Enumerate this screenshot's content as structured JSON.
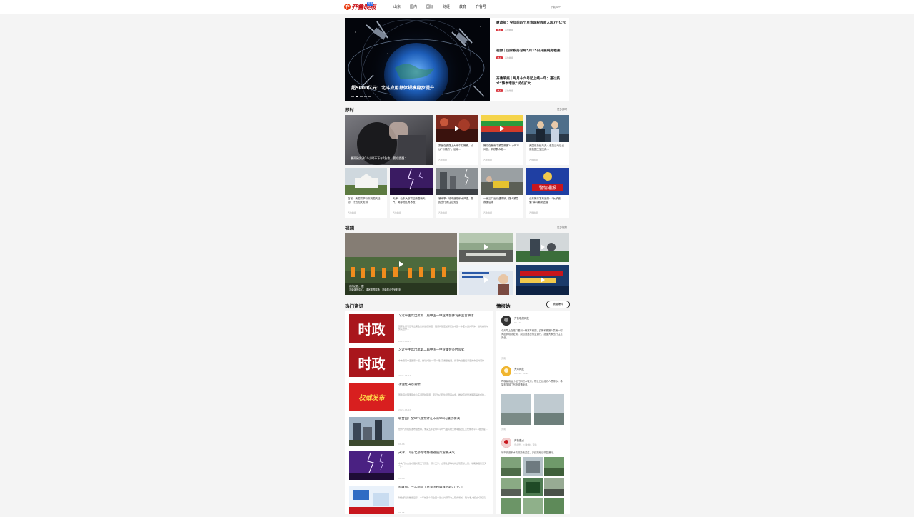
{
  "header": {
    "logo_glyph": "齐",
    "logo_text": "齐鲁晚报",
    "logo_badge": "齐鲁",
    "nav": [
      "山东",
      "国内",
      "国际",
      "财经",
      "教育",
      "齐鲁号"
    ],
    "download": "下载APP"
  },
  "hero": {
    "caption": "超5000亿元！北斗应用总体规模稳步提升",
    "active_slide": 1,
    "slides": 5
  },
  "side_news": [
    {
      "title": "财政部：今年前四个月我国税收收入超7万亿元",
      "tag": "热点",
      "source": "齐鲁晚报"
    },
    {
      "title": "视频｜国家税务总局5月15日开展税务稽查",
      "tag": "热点",
      "source": "齐鲁晚报"
    },
    {
      "title": "齐鲁荣报｜每月十六号起上线一年：通过技术“降本增效”试点扩大",
      "tag": "热点",
      "source": "齐鲁晚报"
    }
  ],
  "instant": {
    "title": "即时",
    "more": "更多即时",
    "big": {
      "caption": "暴雨致男孩24小时不下车?急救，警方提醒：..."
    },
    "cards": [
      {
        "title": "乘客在铁路上大雨中打警察，小伙“有钱的”，后续...",
        "source": "齐鲁晚报"
      },
      {
        "title": "警方在暴雨中紧急救援24小时不间断，转移群众超...",
        "source": "齐鲁晚报"
      },
      {
        "title": "美国前总统与夫人参加活动后出席英国王室庆典...",
        "source": "齐鲁晚报"
      },
      {
        "title": "白宫：美国将举行庆祝国庆活动，计划相关安排",
        "source": "齐鲁晚报"
      },
      {
        "title": "天津：山东大部将迎来雷雨天气，局部地区有冰雹",
        "source": "齐鲁晚报"
      },
      {
        "title": "暴雨季：城市道路积水严重，居民出行请注意安全",
        "source": "齐鲁晚报"
      },
      {
        "title": "一家三口出行遇事故，路人紧急救援后续",
        "source": "齐鲁晚报"
      },
      {
        "title": "山东警方发布通报：“女子被骗”事件最新进展",
        "source": "齐鲁晚报"
      }
    ]
  },
  "video": {
    "title": "视频",
    "more": "更多视频",
    "big_caption_1": "我们必胜，胜！",
    "big_caption_2": "济南体育中心，球迷观赛现场 · 济南泰山夺冠时刻"
  },
  "hot": {
    "title": "热门资讯",
    "items": [
      {
        "thumb_label": "时政",
        "title": "习近平主席出席第二届中国—中亚峰会并发表主旨讲话",
        "desc": "国家主席习近平出席会议并发表讲话，强调构建更加紧密的中国—中亚命运共同体，推动各领域务实合作...",
        "date": "2025-06-17"
      },
      {
        "thumb_label": "时政",
        "title": "习近平主席出席第二届中国—中亚峰会签约仪式",
        "desc": "中方愿同中亚国家一道，推动共建“一带一路”高质量发展，携手构建更加紧密的命运共同体...",
        "date": "2025-06-17"
      },
      {
        "thumb_label": "权威发布",
        "title": "李强在山东调研",
        "desc": "国务院总理李强在山东调研时强调，坚定信心稳住经济基本盘，推动高质量发展取得新成效...",
        "date": "2025-06-16"
      },
      {
        "thumb_label": "",
        "title": "联合国：全球气温预计在未来5年内屡创新高",
        "desc": "世界气象组织发布报告称，未来五年全球年平均气温有较大概率超过工业化前水平1.5摄氏度...",
        "date": "06-16"
      },
      {
        "thumb_label": "",
        "title": "天津、山东北部等地将遭遇强风雷暴天气",
        "desc": "中央气象台发布强对流天气预警，预计天津、山东北部等地将出现雷暴大风、冰雹等强对流天气...",
        "date": "06-16"
      },
      {
        "thumb_label": "",
        "title": "财政部：今年前四个月我国税收收入超7万亿元",
        "desc": "财政部最新数据显示，今年前四个月全国一般公共预算收入稳步增长，税收收入超过7万亿元...",
        "date": "06-15"
      }
    ]
  },
  "intel": {
    "title": "情报站",
    "publish_button": "我要爆料",
    "posts": [
      {
        "name": "齐鲁晚报网友",
        "time": "06-17",
        "text": "今天早上在路口看到一辆货车侧翻，交警和救援人员第一时间赶到现场处置，周边道路已恢复通行，提醒大家出行注意安全。",
        "foot": "济南"
      },
      {
        "name": "大众网友",
        "time": "06-16 · 10:18",
        "text": "昨晚暴雨后小区门口积水较深，物业已经组织人员排水，希望相关部门尽快疏通管道。",
        "foot": "济南"
      },
      {
        "name": "齐鲁壹点",
        "time": "壹点号 · 2小时前 · 现场",
        "text": "城市街道积水情况持续关注，多处路段已恢复通行。",
        "foot": ""
      }
    ]
  },
  "colors": {
    "brand": "#c8161d",
    "accent": "#2d6ee8",
    "tag": "#d9363e"
  }
}
